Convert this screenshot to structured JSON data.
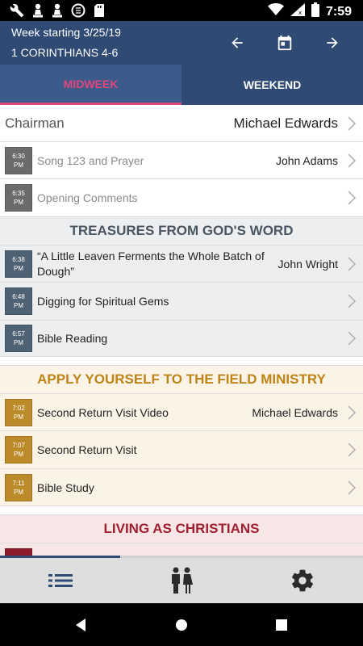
{
  "status_bar": {
    "time": "7:59",
    "left_icons": [
      "wrench-icon",
      "chess-pawn-icon",
      "chess-pawn-icon",
      "data-saver-icon",
      "sd-card-icon"
    ],
    "right_icons": [
      "wifi-icon",
      "signal-icon",
      "battery-icon"
    ]
  },
  "header": {
    "week_label": "Week starting 3/25/19",
    "scripture": "1 CORINTHIANS 4-6",
    "icons": [
      "arrow-back-icon",
      "calendar-icon",
      "arrow-forward-icon"
    ]
  },
  "tabs": [
    {
      "label": "MIDWEEK",
      "active": true
    },
    {
      "label": "WEEKEND",
      "active": false
    }
  ],
  "chairman": {
    "label": "Chairman",
    "name": "Michael Edwards"
  },
  "opening": [
    {
      "time": "6:30",
      "ampm": "PM",
      "title": "Song 123 and Prayer",
      "assignee": "John Adams"
    },
    {
      "time": "6:35",
      "ampm": "PM",
      "title": "Opening Comments",
      "assignee": ""
    }
  ],
  "sections": {
    "treasures": {
      "title": "TREASURES FROM GOD'S WORD",
      "color": "#4b5562",
      "items": [
        {
          "time": "6:38",
          "ampm": "PM",
          "title": "“A Little Leaven Ferments the Whole Batch of Dough”",
          "assignee": "John Wright"
        },
        {
          "time": "6:48",
          "ampm": "PM",
          "title": "Digging for Spiritual Gems",
          "assignee": ""
        },
        {
          "time": "6:57",
          "ampm": "PM",
          "title": "Bible Reading",
          "assignee": ""
        }
      ]
    },
    "apply": {
      "title": "APPLY YOURSELF TO THE FIELD MINISTRY",
      "color": "#bf8417",
      "items": [
        {
          "time": "7:02",
          "ampm": "PM",
          "title": "Second Return Visit Video",
          "assignee": "Michael Edwards"
        },
        {
          "time": "7:07",
          "ampm": "PM",
          "title": "Second Return Visit",
          "assignee": ""
        },
        {
          "time": "7:11",
          "ampm": "PM",
          "title": "Bible Study",
          "assignee": ""
        }
      ]
    },
    "living": {
      "title": "LIVING AS CHRISTIANS",
      "color": "#a11f2f"
    }
  },
  "scroll_progress": 0.33,
  "bottom_nav": {
    "items": [
      {
        "icon": "list-icon",
        "active": true
      },
      {
        "icon": "people-icon",
        "active": false
      },
      {
        "icon": "settings-icon",
        "active": false
      }
    ]
  },
  "system_nav": [
    "back-icon",
    "home-icon",
    "recents-icon"
  ],
  "colors": {
    "primary": "#2f4b73",
    "accent": "#e0457b"
  }
}
